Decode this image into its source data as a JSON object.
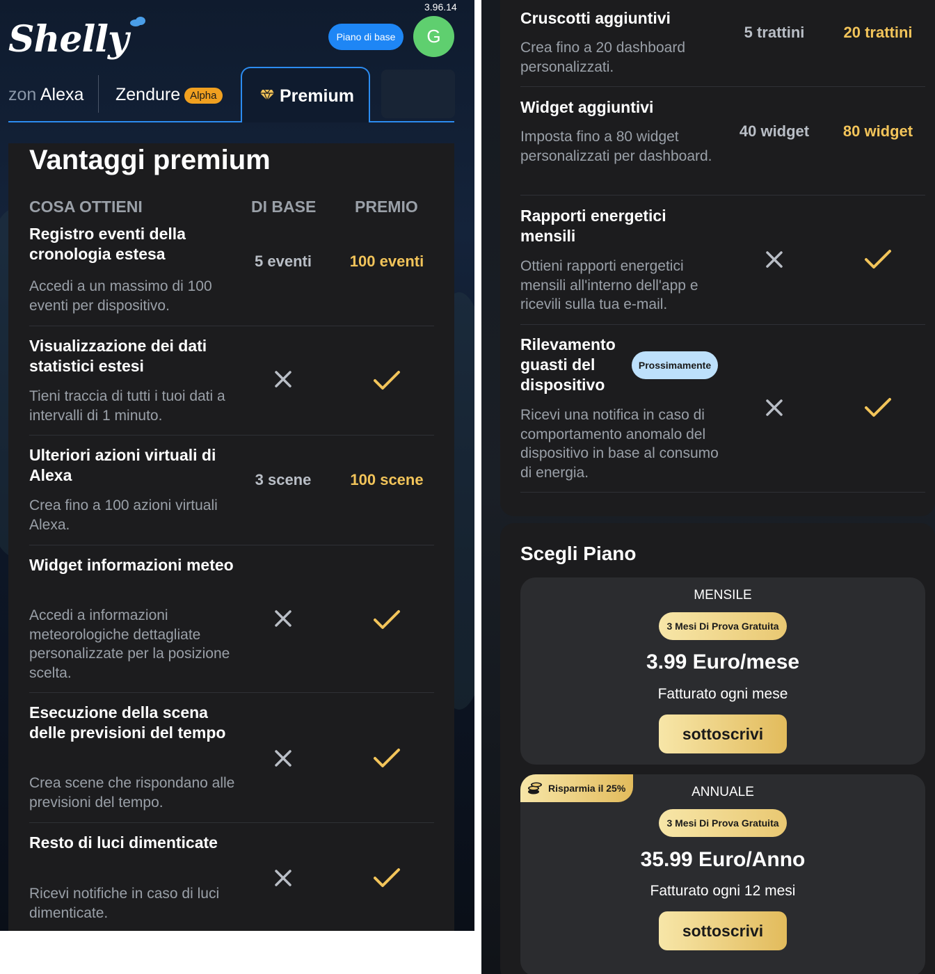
{
  "header": {
    "version": "3.96.14",
    "logo_text": "Shelly",
    "plan_pill": "Piano di base",
    "avatar_initial": "G"
  },
  "tabs": {
    "alexa_prefix": "zon",
    "alexa_label": " Alexa",
    "zendure_label": "Zendure",
    "zendure_badge": "Alpha",
    "premium_label": "Premium"
  },
  "benefits": {
    "title": "Vantaggi premium",
    "col_what": "COSA OTTIENI",
    "col_base": "DI BASE",
    "col_premium": "PREMIO",
    "rows": [
      {
        "title": "Registro eventi della cronologia estesa",
        "desc": "Accedi a un massimo di 100 eventi per dispositivo.",
        "base": "5 eventi",
        "premium": "100 eventi"
      },
      {
        "title": "Visualizzazione dei dati statistici estesi",
        "desc": "Tieni traccia di tutti i tuoi dati a intervalli di 1 minuto.",
        "base_icon": "cross-icon",
        "premium_icon": "check-icon"
      },
      {
        "title": "Ulteriori azioni virtuali di Alexa",
        "desc": "Crea fino a 100 azioni virtuali Alexa.",
        "base": "3 scene",
        "premium": "100 scene"
      },
      {
        "title": "Widget informazioni meteo",
        "desc": "Accedi a informazioni meteorologiche dettagliate personalizzate per la posizione scelta.",
        "base_icon": "cross-icon",
        "premium_icon": "check-icon"
      },
      {
        "title": "Esecuzione della scena delle previsioni del tempo",
        "desc": "Crea scene che rispondano alle previsioni del tempo.",
        "base_icon": "cross-icon",
        "premium_icon": "check-icon"
      },
      {
        "title": "Resto di luci dimenticate",
        "desc": "Ricevi notifiche in caso di luci dimenticate.",
        "base_icon": "cross-icon",
        "premium_icon": "check-icon"
      },
      {
        "title": "Cruscotti aggiuntivi",
        "desc": "Crea fino a 20 dashboard personalizzati.",
        "base": "5 trattini",
        "premium": "20 trattini"
      },
      {
        "title": "Widget aggiuntivi",
        "desc": "Imposta fino a 80 widget personalizzati per dashboard.",
        "base": "40 widget",
        "premium": "80 widget"
      },
      {
        "title": "Rapporti energetici mensili",
        "desc": "Ottieni rapporti energetici mensili all'interno dell'app e ricevili sulla tua e-mail.",
        "base_icon": "cross-icon",
        "premium_icon": "check-icon"
      },
      {
        "title": "Rilevamento guasti del dispositivo",
        "badge": "Prossimamente",
        "desc": "Ricevi una notifica in caso di comportamento anomalo del dispositivo in base al consumo di energia.",
        "base_icon": "cross-icon",
        "premium_icon": "check-icon"
      }
    ]
  },
  "plans": {
    "title": "Scegli Piano",
    "monthly": {
      "name": "MENSILE",
      "trial": "3 Mesi Di Prova Gratuita",
      "price": "3.99 Euro/mese",
      "billed": "Fatturato ogni mese",
      "button": "sottoscrivi"
    },
    "annual": {
      "name": "ANNUALE",
      "save_badge": "Risparmia il 25%",
      "trial": "3 Mesi Di Prova Gratuita",
      "price": "35.99 Euro/Anno",
      "billed": "Fatturato ogni 12 mesi",
      "button": "sottoscrivi"
    }
  },
  "colors": {
    "accent_blue": "#2c8cf0",
    "gold": "#f2c45a",
    "card_bg": "#1c1c1e",
    "avatar_green": "#5fcf6f"
  }
}
